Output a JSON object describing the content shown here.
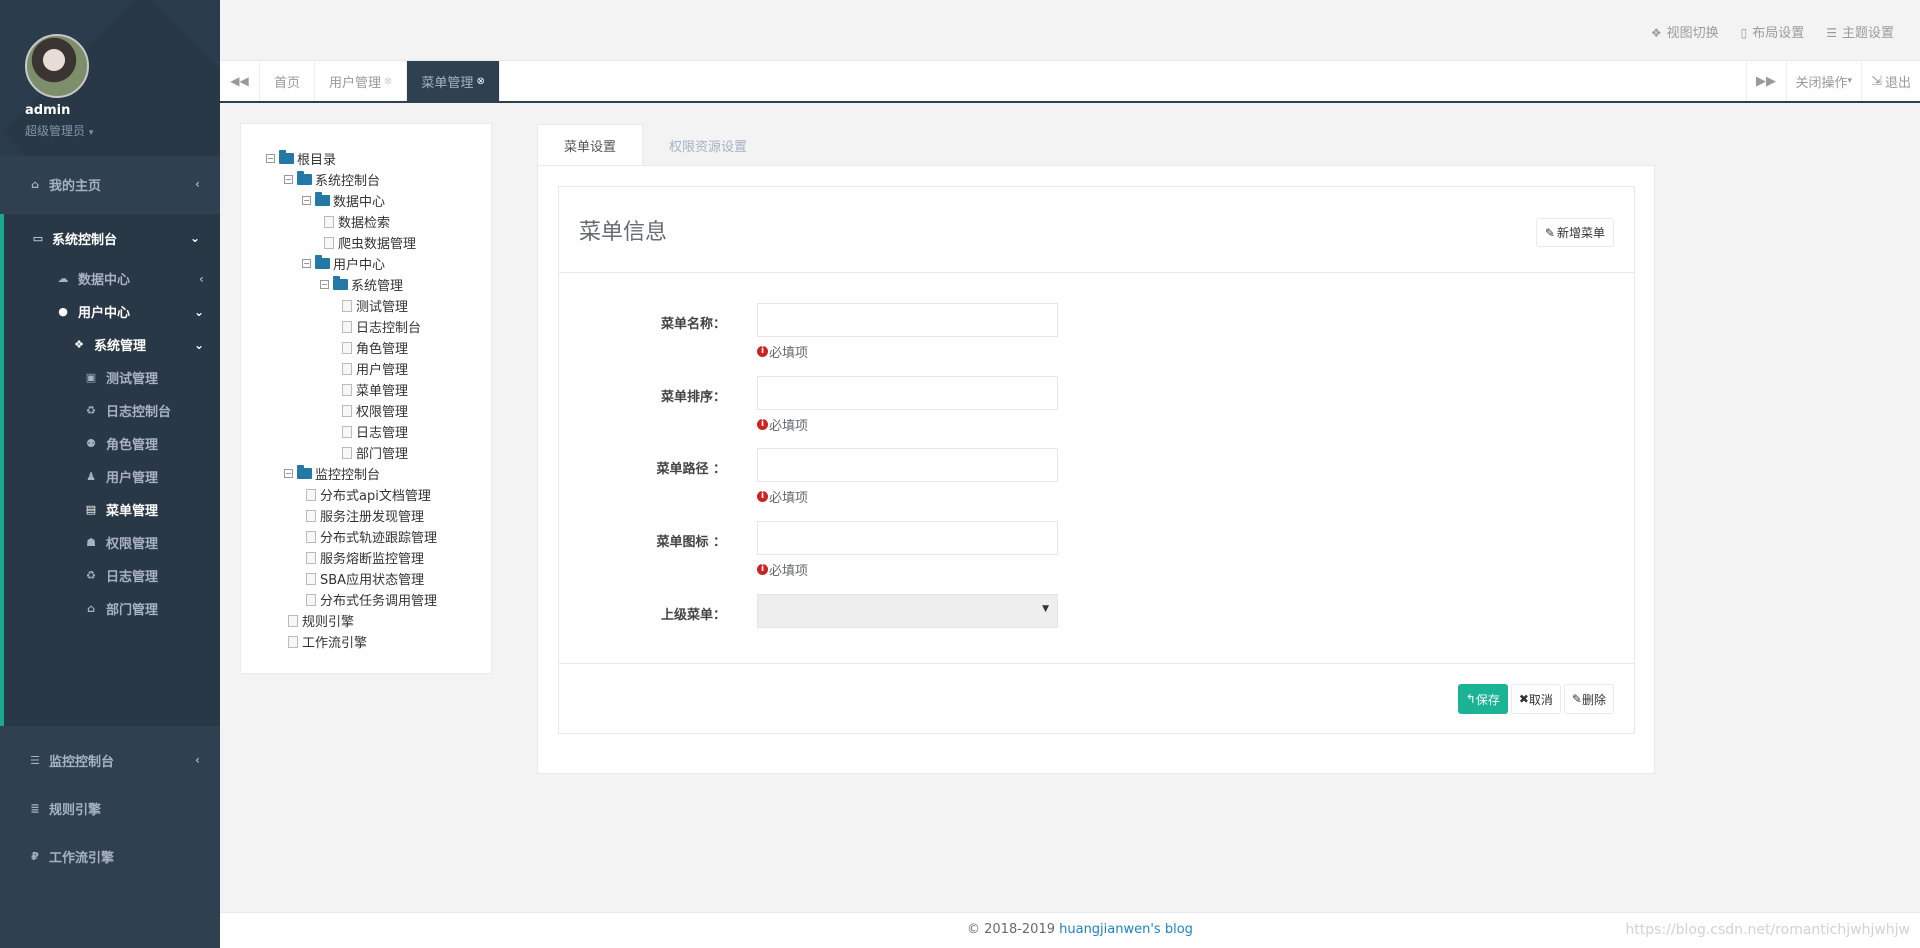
{
  "profile": {
    "name": "admin",
    "role": "超级管理员"
  },
  "sidebar": {
    "home": "我的主页",
    "system_console": "系统控制台",
    "data_center": "数据中心",
    "user_center": "用户中心",
    "system_mgmt": "系统管理",
    "sub_items": [
      "测试管理",
      "日志控制台",
      "角色管理",
      "用户管理",
      "菜单管理",
      "权限管理",
      "日志管理",
      "部门管理"
    ],
    "monitor_console": "监控控制台",
    "rule_engine": "规则引擎",
    "workflow_engine": "工作流引擎"
  },
  "topbar": {
    "view_switch": "视图切换",
    "layout_settings": "布局设置",
    "theme_settings": "主题设置"
  },
  "tabbar": {
    "tabs": [
      "首页",
      "用户管理",
      "菜单管理"
    ],
    "close_ops": "关闭操作",
    "logout": "退出"
  },
  "tree": {
    "root": "根目录",
    "system_console": "系统控制台",
    "data_center": "数据中心",
    "data_search": "数据检索",
    "crawler_data": "爬虫数据管理",
    "user_center": "用户中心",
    "system_mgmt": "系统管理",
    "sys_children": [
      "测试管理",
      "日志控制台",
      "角色管理",
      "用户管理",
      "菜单管理",
      "权限管理",
      "日志管理",
      "部门管理"
    ],
    "monitor_console": "监控控制台",
    "monitor_children": [
      "分布式api文档管理",
      "服务注册发现管理",
      "分布式轨迹跟踪管理",
      "服务熔断监控管理",
      "SBA应用状态管理",
      "分布式任务调用管理"
    ],
    "rule_engine": "规则引擎",
    "workflow_engine": "工作流引擎"
  },
  "content": {
    "tab_menu": "菜单设置",
    "tab_perm": "权限资源设置",
    "title": "菜单信息",
    "add_button": "新增菜单",
    "fields": {
      "name_label": "菜单名称：",
      "sort_label": "菜单排序：",
      "path_label": "菜单路径 ：",
      "icon_label": "菜单图标 ：",
      "parent_label": "上级菜单："
    },
    "required": "必填项",
    "save": "保存",
    "cancel": "取消",
    "delete": "删除"
  },
  "footer": {
    "copyright": "© 2018-2019 ",
    "link": "huangjianwen's blog",
    "watermark": "https://blog.csdn.net/romantichjwhjwhjw"
  }
}
